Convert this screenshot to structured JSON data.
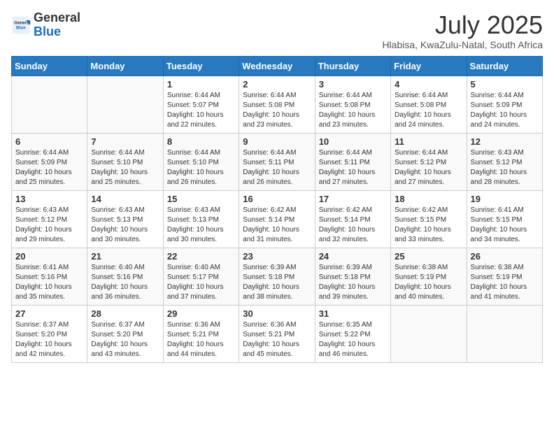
{
  "logo": {
    "general": "General",
    "blue": "Blue"
  },
  "title": "July 2025",
  "subtitle": "Hlabisa, KwaZulu-Natal, South Africa",
  "days_of_week": [
    "Sunday",
    "Monday",
    "Tuesday",
    "Wednesday",
    "Thursday",
    "Friday",
    "Saturday"
  ],
  "weeks": [
    [
      {
        "day": "",
        "info": ""
      },
      {
        "day": "",
        "info": ""
      },
      {
        "day": "1",
        "info": "Sunrise: 6:44 AM\nSunset: 5:07 PM\nDaylight: 10 hours and 22 minutes."
      },
      {
        "day": "2",
        "info": "Sunrise: 6:44 AM\nSunset: 5:08 PM\nDaylight: 10 hours and 23 minutes."
      },
      {
        "day": "3",
        "info": "Sunrise: 6:44 AM\nSunset: 5:08 PM\nDaylight: 10 hours and 23 minutes."
      },
      {
        "day": "4",
        "info": "Sunrise: 6:44 AM\nSunset: 5:08 PM\nDaylight: 10 hours and 24 minutes."
      },
      {
        "day": "5",
        "info": "Sunrise: 6:44 AM\nSunset: 5:09 PM\nDaylight: 10 hours and 24 minutes."
      }
    ],
    [
      {
        "day": "6",
        "info": "Sunrise: 6:44 AM\nSunset: 5:09 PM\nDaylight: 10 hours and 25 minutes."
      },
      {
        "day": "7",
        "info": "Sunrise: 6:44 AM\nSunset: 5:10 PM\nDaylight: 10 hours and 25 minutes."
      },
      {
        "day": "8",
        "info": "Sunrise: 6:44 AM\nSunset: 5:10 PM\nDaylight: 10 hours and 26 minutes."
      },
      {
        "day": "9",
        "info": "Sunrise: 6:44 AM\nSunset: 5:11 PM\nDaylight: 10 hours and 26 minutes."
      },
      {
        "day": "10",
        "info": "Sunrise: 6:44 AM\nSunset: 5:11 PM\nDaylight: 10 hours and 27 minutes."
      },
      {
        "day": "11",
        "info": "Sunrise: 6:44 AM\nSunset: 5:12 PM\nDaylight: 10 hours and 27 minutes."
      },
      {
        "day": "12",
        "info": "Sunrise: 6:43 AM\nSunset: 5:12 PM\nDaylight: 10 hours and 28 minutes."
      }
    ],
    [
      {
        "day": "13",
        "info": "Sunrise: 6:43 AM\nSunset: 5:12 PM\nDaylight: 10 hours and 29 minutes."
      },
      {
        "day": "14",
        "info": "Sunrise: 6:43 AM\nSunset: 5:13 PM\nDaylight: 10 hours and 30 minutes."
      },
      {
        "day": "15",
        "info": "Sunrise: 6:43 AM\nSunset: 5:13 PM\nDaylight: 10 hours and 30 minutes."
      },
      {
        "day": "16",
        "info": "Sunrise: 6:42 AM\nSunset: 5:14 PM\nDaylight: 10 hours and 31 minutes."
      },
      {
        "day": "17",
        "info": "Sunrise: 6:42 AM\nSunset: 5:14 PM\nDaylight: 10 hours and 32 minutes."
      },
      {
        "day": "18",
        "info": "Sunrise: 6:42 AM\nSunset: 5:15 PM\nDaylight: 10 hours and 33 minutes."
      },
      {
        "day": "19",
        "info": "Sunrise: 6:41 AM\nSunset: 5:15 PM\nDaylight: 10 hours and 34 minutes."
      }
    ],
    [
      {
        "day": "20",
        "info": "Sunrise: 6:41 AM\nSunset: 5:16 PM\nDaylight: 10 hours and 35 minutes."
      },
      {
        "day": "21",
        "info": "Sunrise: 6:40 AM\nSunset: 5:16 PM\nDaylight: 10 hours and 36 minutes."
      },
      {
        "day": "22",
        "info": "Sunrise: 6:40 AM\nSunset: 5:17 PM\nDaylight: 10 hours and 37 minutes."
      },
      {
        "day": "23",
        "info": "Sunrise: 6:39 AM\nSunset: 5:18 PM\nDaylight: 10 hours and 38 minutes."
      },
      {
        "day": "24",
        "info": "Sunrise: 6:39 AM\nSunset: 5:18 PM\nDaylight: 10 hours and 39 minutes."
      },
      {
        "day": "25",
        "info": "Sunrise: 6:38 AM\nSunset: 5:19 PM\nDaylight: 10 hours and 40 minutes."
      },
      {
        "day": "26",
        "info": "Sunrise: 6:38 AM\nSunset: 5:19 PM\nDaylight: 10 hours and 41 minutes."
      }
    ],
    [
      {
        "day": "27",
        "info": "Sunrise: 6:37 AM\nSunset: 5:20 PM\nDaylight: 10 hours and 42 minutes."
      },
      {
        "day": "28",
        "info": "Sunrise: 6:37 AM\nSunset: 5:20 PM\nDaylight: 10 hours and 43 minutes."
      },
      {
        "day": "29",
        "info": "Sunrise: 6:36 AM\nSunset: 5:21 PM\nDaylight: 10 hours and 44 minutes."
      },
      {
        "day": "30",
        "info": "Sunrise: 6:36 AM\nSunset: 5:21 PM\nDaylight: 10 hours and 45 minutes."
      },
      {
        "day": "31",
        "info": "Sunrise: 6:35 AM\nSunset: 5:22 PM\nDaylight: 10 hours and 46 minutes."
      },
      {
        "day": "",
        "info": ""
      },
      {
        "day": "",
        "info": ""
      }
    ]
  ]
}
